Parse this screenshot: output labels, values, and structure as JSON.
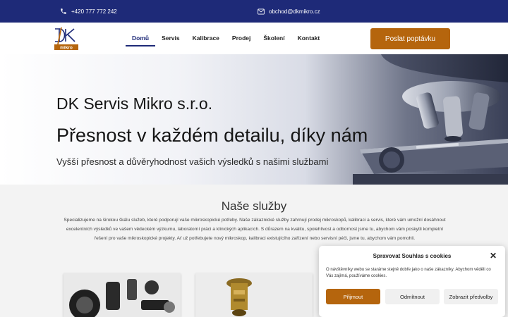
{
  "topbar": {
    "phone": "+420 777 772 242",
    "email": "obchod@dkmikro.cz",
    "phone_icon": "phone-icon",
    "email_icon": "envelope-icon"
  },
  "header": {
    "logo": {
      "mark": "DK",
      "word": "mikro"
    },
    "nav": [
      "Domů",
      "Servis",
      "Kalibrace",
      "Prodej",
      "Školení",
      "Kontakt"
    ],
    "active_nav": "Domů",
    "cta": "Poslat poptávku"
  },
  "hero": {
    "company": "DK Servis Mikro s.r.o.",
    "headline": "Přesnost v každém detailu, díky nám",
    "subheadline": "Vyšší přesnost a důvěryhodnost vašich výsledků s našimi službami"
  },
  "services": {
    "title": "Naše služby",
    "description": "Specializujeme na širokou škálu služeb, které podporují vaše mikroskopické potřeby. Naše zákaznické služby zahrnují prodej mikroskopů, kalibraci a servis, které vám umožní dosáhnout excelentních výsledků ve vašem vědeckém výzkumu, laboratorní práci a klinických aplikacích. S důrazem na kvalitu, spolehlivost a odbornost jsme tu, abychom vám poskytli kompletní řešení pro vaše mikroskopické projekty. Ať už potřebujete nový mikroskop, kalibraci existujícího zařízení nebo servisní péči, jsme tu, abychom vám pomohli."
  },
  "cookie": {
    "title": "Spravovat Souhlas s cookies",
    "text": "O návštěvníky webu se staráme stejně dobře jako o naše zákazníky. Abychom věděli co Vás zajímá, používáme cookies.",
    "accept": "Přijmout",
    "deny": "Odmítnout",
    "preferences": "Zobrazit předvolby"
  },
  "colors": {
    "topbar": "#1e2a78",
    "accent": "#b5650d",
    "nav_active": "#1e2a78"
  }
}
